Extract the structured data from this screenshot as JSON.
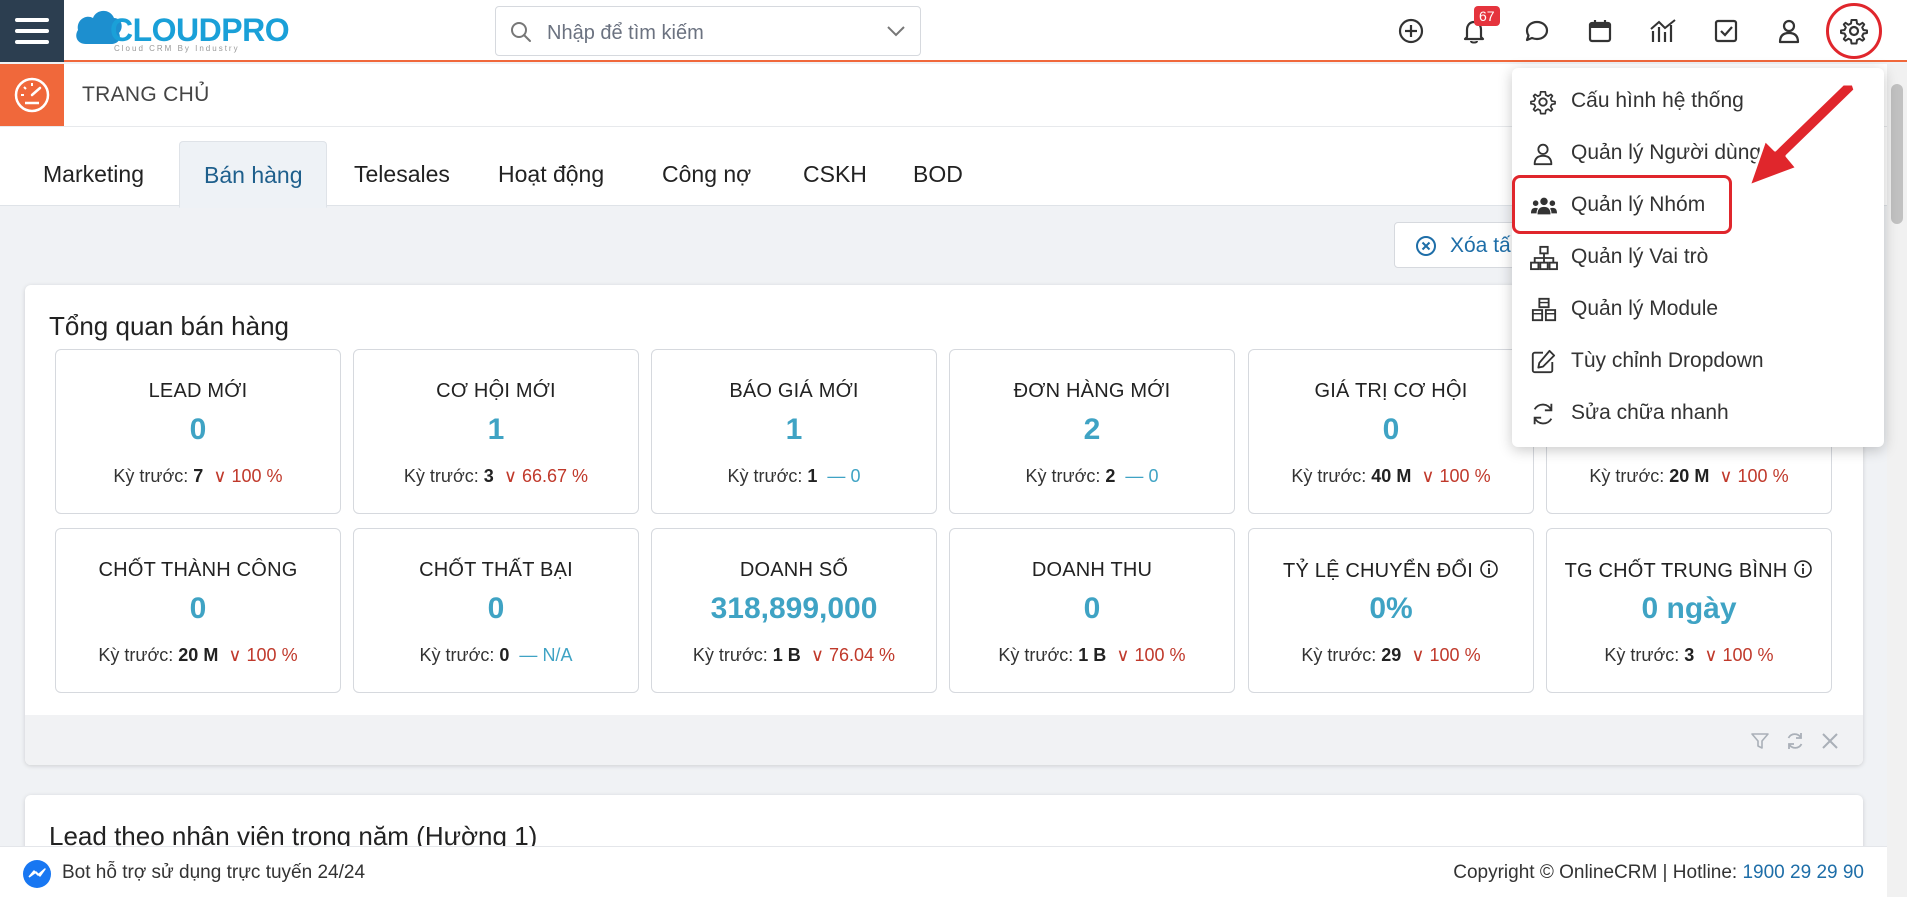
{
  "app": {
    "logo_text": "CLOUDPRO",
    "logo_sub": "Cloud CRM By Industry"
  },
  "search": {
    "placeholder": "Nhập để tìm kiếm"
  },
  "notifications": {
    "count": "67"
  },
  "header": {
    "page_title": "TRANG CHỦ"
  },
  "tabs": [
    {
      "label": "Marketing"
    },
    {
      "label": "Bán hàng"
    },
    {
      "label": "Telesales"
    },
    {
      "label": "Hoạt động"
    },
    {
      "label": "Công nợ"
    },
    {
      "label": "CSKH"
    },
    {
      "label": "BOD"
    }
  ],
  "clear_button": {
    "label": "Xóa tấ"
  },
  "overview": {
    "title": "Tổng quan bán hàng",
    "prev_label": "Kỳ trước:",
    "cards": [
      {
        "label": "LEAD MỚI",
        "value": "0",
        "prev": "7",
        "change": "100 %",
        "trend": "down"
      },
      {
        "label": "CƠ HỘI MỚI",
        "value": "1",
        "prev": "3",
        "change": "66.67 %",
        "trend": "down"
      },
      {
        "label": "BÁO GIÁ MỚI",
        "value": "1",
        "prev": "1",
        "change": "0",
        "trend": "flat"
      },
      {
        "label": "ĐƠN HÀNG MỚI",
        "value": "2",
        "prev": "2",
        "change": "0",
        "trend": "flat"
      },
      {
        "label": "GIÁ TRỊ CƠ HỘI",
        "value": "0",
        "prev": "40 M",
        "change": "100 %",
        "trend": "down"
      },
      {
        "label": "",
        "value": "",
        "prev": "20 M",
        "change": "100 %",
        "trend": "down"
      },
      {
        "label": "CHỐT THÀNH CÔNG",
        "value": "0",
        "prev": "20 M",
        "change": "100 %",
        "trend": "down"
      },
      {
        "label": "CHỐT THẤT BẠI",
        "value": "0",
        "prev": "0",
        "change": "N/A",
        "trend": "flat"
      },
      {
        "label": "DOANH SỐ",
        "value": "318,899,000",
        "prev": "1 B",
        "change": "76.04 %",
        "trend": "down"
      },
      {
        "label": "DOANH THU",
        "value": "0",
        "prev": "1 B",
        "change": "100 %",
        "trend": "down"
      },
      {
        "label": "TỶ LỆ CHUYỂN ĐỔI",
        "value": "0%",
        "prev": "29",
        "change": "100 %",
        "trend": "down",
        "info": true
      },
      {
        "label": "TG CHỐT TRUNG BÌNH",
        "value": "0 ngày",
        "prev": "3",
        "change": "100 %",
        "trend": "down",
        "info": true
      }
    ]
  },
  "second_panel": {
    "title": "Lead theo nhân viên trong năm (Hường 1)"
  },
  "settings_menu": {
    "items": [
      {
        "label": "Cấu hình hệ thống",
        "icon": "gear-icon"
      },
      {
        "label": "Quản lý Người dùng",
        "icon": "user-icon"
      },
      {
        "label": "Quản lý Nhóm",
        "icon": "users-group-icon"
      },
      {
        "label": "Quản lý Vai trò",
        "icon": "sitemap-icon"
      },
      {
        "label": "Quản lý Module",
        "icon": "cubes-icon"
      },
      {
        "label": "Tùy chỉnh Dropdown",
        "icon": "edit-icon"
      },
      {
        "label": "Sửa chữa nhanh",
        "icon": "sync-icon"
      }
    ]
  },
  "footer": {
    "bot_text": "Bot hỗ trợ sử dụng trực tuyến 24/24",
    "copyright": "Copyright © OnlineCRM | Hotline: ",
    "hotline": "1900 29 29 90"
  },
  "colors": {
    "accent": "#f0683b",
    "sidebar_dark": "#2c3e50",
    "value_blue": "#3fa3c4",
    "down_red": "#c0392b",
    "annotation_red": "#e0262c"
  }
}
